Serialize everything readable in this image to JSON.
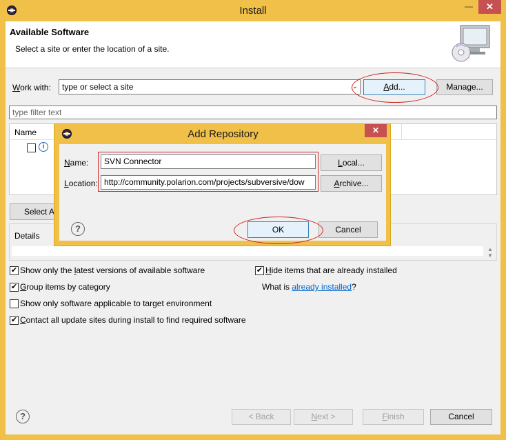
{
  "window": {
    "title": "Install",
    "minimize_glyph": "—",
    "close_glyph": "✕",
    "app_icon": "eclipse-icon"
  },
  "header": {
    "title": "Available Software",
    "subtitle": "Select a site or enter the location of a site.",
    "icon": "install-monitor-cd-icon"
  },
  "work_with": {
    "label_accel": "W",
    "label_rest": "ork with:",
    "value": "type or select a site",
    "add_accel": "A",
    "add_rest": "dd...",
    "manage_label": "Manage..."
  },
  "filter": {
    "placeholder": "type filter text"
  },
  "tree": {
    "column_name": "Name",
    "row_icon": "info-icon",
    "select_all_label": "Select Al"
  },
  "details": {
    "label": "Details"
  },
  "options": {
    "latest_pre": "Show only the ",
    "latest_accel": "l",
    "latest_post": "atest versions of available software",
    "latest_checked": true,
    "hide_accel": "H",
    "hide_rest": "ide items that are already installed",
    "hide_checked": true,
    "group_accel": "G",
    "group_rest": "roup items by category",
    "group_checked": true,
    "what_is": "What is ",
    "already_installed_link": "already installed",
    "question_mark": "?",
    "target_env": "Show only software applicable to target environment",
    "target_checked": false,
    "contact_accel": "C",
    "contact_rest": "ontact all update sites during install to find required software",
    "contact_checked": true
  },
  "footer": {
    "back_label": "< Back",
    "next_accel": "N",
    "next_rest": "ext >",
    "finish_accel": "F",
    "finish_rest": "inish",
    "cancel_label": "Cancel"
  },
  "dialog": {
    "title": "Add Repository",
    "name_accel": "N",
    "name_rest": "ame:",
    "name_value": "SVN Connector",
    "location_accel": "L",
    "location_rest": "ocation:",
    "location_value": "http://community.polarion.com/projects/subversive/dow",
    "local_accel": "L",
    "local_rest": "ocal...",
    "archive_accel": "A",
    "archive_rest": "rchive...",
    "ok_label": "OK",
    "cancel_label": "Cancel",
    "close_glyph": "✕",
    "help_glyph": "?"
  },
  "colors": {
    "frame": "#f0c048",
    "close_red": "#c75050",
    "link": "#0066cc",
    "annotation_red": "#cc2222"
  }
}
